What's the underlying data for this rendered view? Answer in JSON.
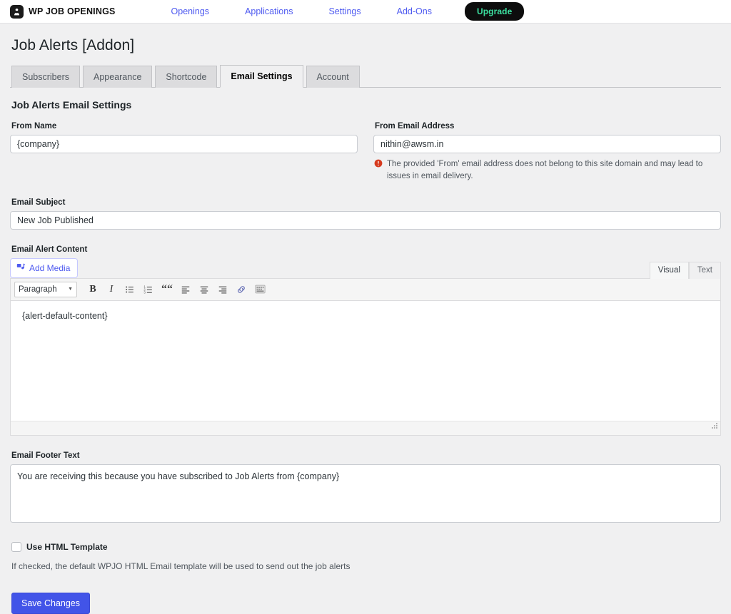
{
  "topbar": {
    "brand_name": "WP JOB OPENINGS",
    "logo_icon": "briefcase-person-logo",
    "nav": [
      {
        "label": "Openings"
      },
      {
        "label": "Applications"
      },
      {
        "label": "Settings"
      },
      {
        "label": "Add-Ons"
      }
    ],
    "upgrade_label": "Upgrade",
    "accent_link_color": "#4e5af0",
    "upgrade_bg": "#0d0d0d",
    "upgrade_text_color": "#3ce0a0"
  },
  "page": {
    "title": "Job Alerts [Addon]",
    "tabs": [
      {
        "label": "Subscribers",
        "active": false
      },
      {
        "label": "Appearance",
        "active": false
      },
      {
        "label": "Shortcode",
        "active": false
      },
      {
        "label": "Email Settings",
        "active": true
      },
      {
        "label": "Account",
        "active": false
      }
    ],
    "section_title": "Job Alerts Email Settings"
  },
  "form": {
    "from_name": {
      "label": "From Name",
      "value": "{company}"
    },
    "from_email": {
      "label": "From Email Address",
      "value": "nithin@awsm.in",
      "notice": "The provided 'From' email address does not belong to this site domain and may lead to issues in email delivery.",
      "notice_icon": "warning-circle-icon",
      "notice_icon_color": "#d63a1e"
    },
    "email_subject": {
      "label": "Email Subject",
      "value": "New Job Published"
    },
    "email_alert_content": {
      "label": "Email Alert Content",
      "add_media_label": "Add Media",
      "add_media_icon": "media-icon",
      "editor_tabs": [
        {
          "label": "Visual",
          "active": true
        },
        {
          "label": "Text",
          "active": false
        }
      ],
      "toolbar": {
        "format_select_value": "Paragraph",
        "buttons": [
          {
            "name": "bold-button",
            "glyph": "B"
          },
          {
            "name": "italic-button",
            "glyph": "I"
          },
          {
            "name": "bulleted-list-button",
            "glyph": ""
          },
          {
            "name": "numbered-list-button",
            "glyph": ""
          },
          {
            "name": "blockquote-button",
            "glyph": "“"
          },
          {
            "name": "align-left-button",
            "glyph": ""
          },
          {
            "name": "align-center-button",
            "glyph": ""
          },
          {
            "name": "align-right-button",
            "glyph": ""
          },
          {
            "name": "insert-link-button",
            "glyph": ""
          },
          {
            "name": "toolbar-toggle-button",
            "glyph": ""
          }
        ]
      },
      "content": "{alert-default-content}"
    },
    "email_footer": {
      "label": "Email Footer Text",
      "value": "You are receiving this because you have subscribed to Job Alerts from {company}"
    },
    "use_html_template": {
      "label": "Use HTML Template",
      "checked": false,
      "help_text": "If checked, the default WPJO HTML Email template will be used to send out the job alerts"
    },
    "save_label": "Save Changes",
    "save_color": "#4254e8"
  }
}
